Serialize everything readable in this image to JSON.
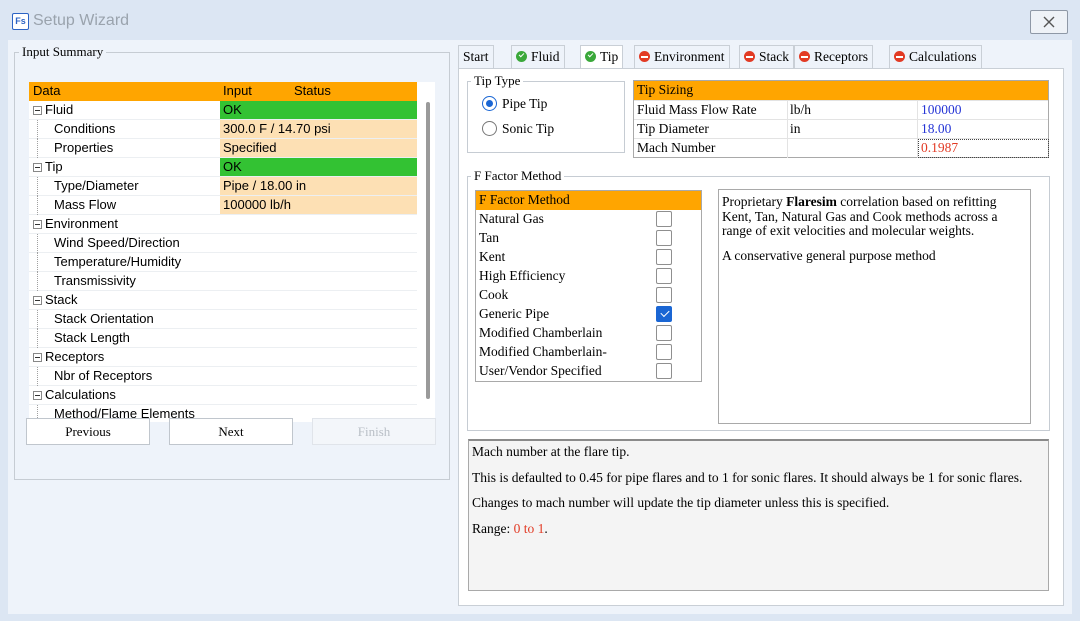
{
  "window": {
    "title": "Setup Wizard",
    "app_icon": "Fs",
    "close_icon": "close-icon"
  },
  "summary": {
    "title": "Input Summary",
    "headers": {
      "data": "Data",
      "input": "Input",
      "status": "Status"
    },
    "rows": [
      {
        "label": "Fluid",
        "level": 0,
        "value": "OK",
        "style": "ok"
      },
      {
        "label": "Conditions",
        "level": 1,
        "value": "300.0 F / 14.70 psi",
        "style": "val"
      },
      {
        "label": "Properties",
        "level": 1,
        "value": "Specified",
        "style": "val"
      },
      {
        "label": "Tip",
        "level": 0,
        "value": "OK",
        "style": "ok"
      },
      {
        "label": "Type/Diameter",
        "level": 1,
        "value": "Pipe / 18.00 in",
        "style": "val"
      },
      {
        "label": "Mass Flow",
        "level": 1,
        "value": "100000 lb/h",
        "style": "val"
      },
      {
        "label": "Environment",
        "level": 0,
        "value": "",
        "style": ""
      },
      {
        "label": "Wind Speed/Direction",
        "level": 1,
        "value": "",
        "style": ""
      },
      {
        "label": "Temperature/Humidity",
        "level": 1,
        "value": "",
        "style": ""
      },
      {
        "label": "Transmissivity",
        "level": 1,
        "value": "",
        "style": ""
      },
      {
        "label": "Stack",
        "level": 0,
        "value": "",
        "style": ""
      },
      {
        "label": "Stack Orientation",
        "level": 1,
        "value": "",
        "style": ""
      },
      {
        "label": "Stack Length",
        "level": 1,
        "value": "",
        "style": ""
      },
      {
        "label": "Receptors",
        "level": 0,
        "value": "",
        "style": ""
      },
      {
        "label": "Nbr of Receptors",
        "level": 1,
        "value": "",
        "style": ""
      },
      {
        "label": "Calculations",
        "level": 0,
        "value": "",
        "style": ""
      },
      {
        "label": "Method/Flame Elements",
        "level": 1,
        "value": "",
        "style": ""
      }
    ]
  },
  "buttons": {
    "previous": "Previous",
    "next": "Next",
    "finish": "Finish"
  },
  "tabs": [
    {
      "label": "Start",
      "icon": "",
      "active": false
    },
    {
      "label": "Fluid",
      "icon": "check",
      "active": false
    },
    {
      "label": "Tip",
      "icon": "check",
      "active": true
    },
    {
      "label": "Environment",
      "icon": "err",
      "active": false
    },
    {
      "label": "Stack",
      "icon": "err",
      "active": false
    },
    {
      "label": "Receptors",
      "icon": "err",
      "active": false
    },
    {
      "label": "Calculations",
      "icon": "err",
      "active": false
    }
  ],
  "tip_type": {
    "title": "Tip Type",
    "options": [
      {
        "label": "Pipe Tip",
        "selected": true
      },
      {
        "label": "Sonic Tip",
        "selected": false
      }
    ]
  },
  "tip_sizing": {
    "title": "Tip Sizing",
    "rows": [
      {
        "label": "Fluid Mass Flow Rate",
        "unit": "lb/h",
        "value": "100000",
        "highlight": false
      },
      {
        "label": "Tip Diameter",
        "unit": "in",
        "value": "18.00",
        "highlight": false
      },
      {
        "label": "Mach Number",
        "unit": "",
        "value": "0.1987",
        "highlight": true
      }
    ]
  },
  "f_factor": {
    "title": "F Factor Method",
    "list_header": "F Factor Method",
    "methods": [
      {
        "label": "Natural Gas",
        "checked": false
      },
      {
        "label": "Tan",
        "checked": false
      },
      {
        "label": "Kent",
        "checked": false
      },
      {
        "label": "High Efficiency",
        "checked": false
      },
      {
        "label": "Cook",
        "checked": false
      },
      {
        "label": "Generic Pipe",
        "checked": true
      },
      {
        "label": "Modified Chamberlain",
        "checked": false
      },
      {
        "label": "Modified Chamberlain-",
        "checked": false
      },
      {
        "label": "User/Vendor Specified",
        "checked": false
      }
    ],
    "description": {
      "prefix": "Proprietary ",
      "bold": "Flaresim",
      "suffix": " correlation based on refitting Kent, Tan, Natural Gas and Cook methods across a range of exit velocities and molecular weights.",
      "second": "A conservative general purpose method"
    }
  },
  "help": {
    "line1": "Mach number at the flare tip.",
    "line2": "This is defaulted to 0.45 for pipe flares and to 1 for sonic flares. It should always be 1 for sonic flares.",
    "line3": "Changes to mach number will update the tip diameter unless this is specified.",
    "range_label": "Range: ",
    "range_value": "0 to 1",
    "range_end": "."
  },
  "colors": {
    "header_orange": "#ffa500",
    "ok_green": "#33c233",
    "value_peach": "#fde0b4",
    "accent_blue": "#1a66d4",
    "error_red": "#e23a24"
  }
}
